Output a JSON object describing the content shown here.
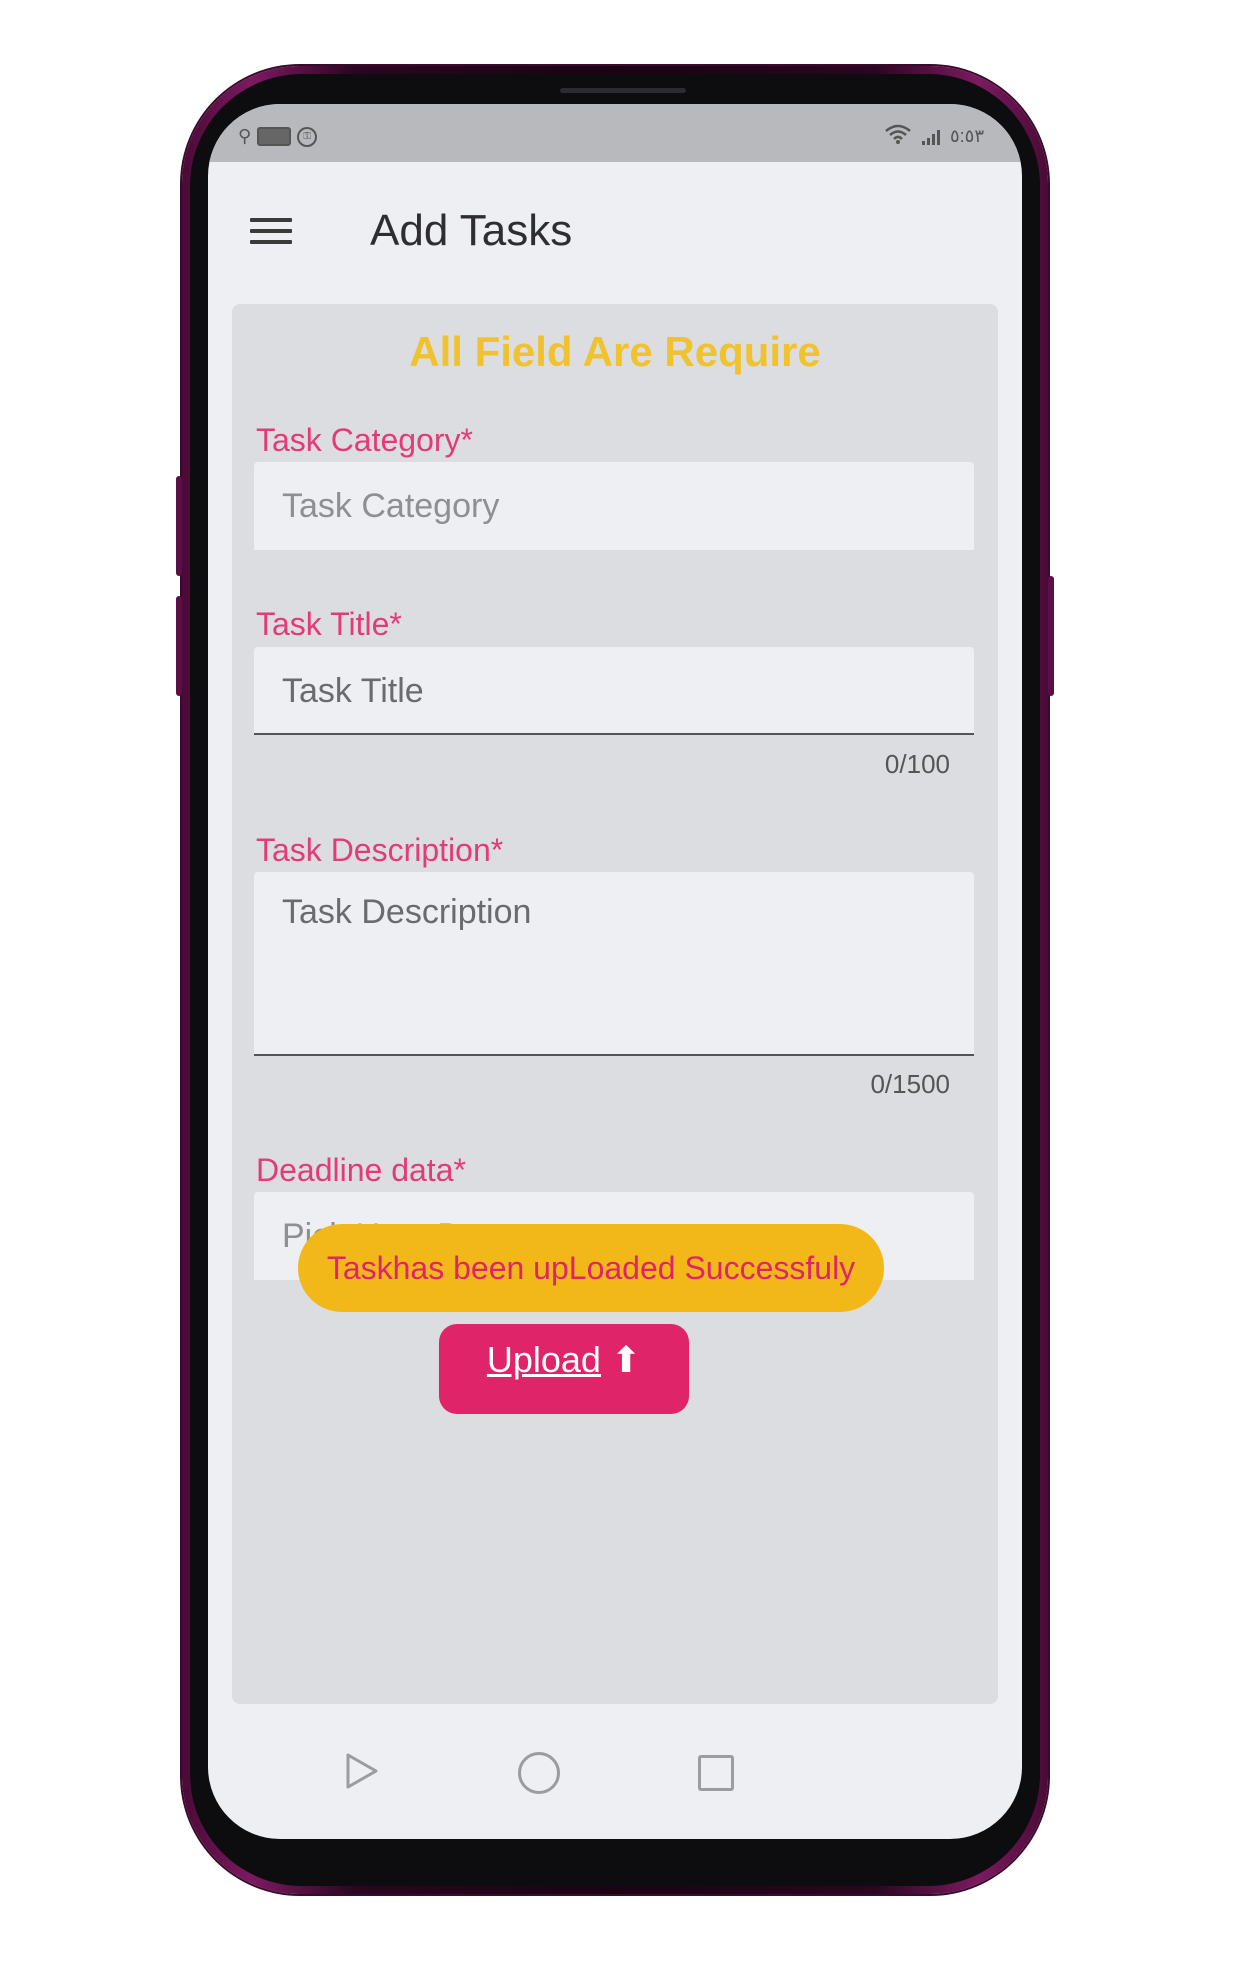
{
  "status_bar": {
    "time": "٥:٥٣"
  },
  "app_bar": {
    "title": "Add Tasks"
  },
  "form": {
    "heading": "All Field Are Require",
    "category": {
      "label": "Task Category*",
      "placeholder": "Task Category"
    },
    "title": {
      "label": "Task Title*",
      "placeholder": "Task Title",
      "counter": "0/100"
    },
    "description": {
      "label": "Task Description*",
      "placeholder": "Task Description",
      "counter": "0/1500"
    },
    "deadline": {
      "label": "Deadline data*",
      "placeholder": "Pick Up a Data"
    },
    "upload_label": "Upload"
  },
  "toast": {
    "message": "Taskhas been upLoaded Successfuly"
  },
  "colors": {
    "accent_pink": "#e0246a",
    "heading_yellow": "#f0c22e",
    "toast_yellow": "#f2b81a"
  }
}
